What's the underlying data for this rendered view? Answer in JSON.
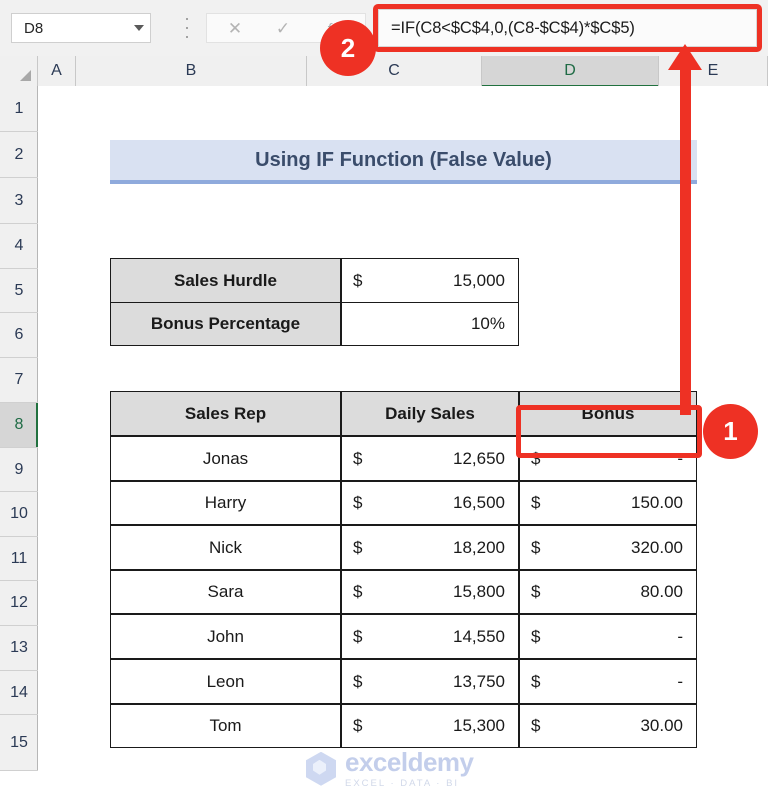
{
  "formula_bar": {
    "name_box_value": "D8",
    "cancel_icon": "close-icon",
    "enter_icon": "check-icon",
    "function_icon": "fx-icon",
    "formula": "=IF(C8<$C$4,0,(C8-$C$4)*$C$5)"
  },
  "grid": {
    "columns": [
      "A",
      "B",
      "C",
      "D",
      "E"
    ],
    "selected_column": "D",
    "rows": [
      "1",
      "2",
      "3",
      "4",
      "5",
      "6",
      "7",
      "8",
      "9",
      "10",
      "11",
      "12",
      "13",
      "14",
      "15"
    ],
    "selected_row": "8"
  },
  "banner": {
    "title": "Using IF Function (False Value)"
  },
  "params_table": {
    "rows": [
      {
        "label": "Sales Hurdle",
        "currency": "$",
        "value": "15,000"
      },
      {
        "label": "Bonus Percentage",
        "currency": "",
        "value": "10%"
      }
    ]
  },
  "data_table": {
    "headers": [
      "Sales Rep",
      "Daily Sales",
      "Bonus"
    ],
    "rows": [
      {
        "rep": "Jonas",
        "sales_cur": "$",
        "sales": "12,650",
        "bonus_cur": "$",
        "bonus": "-"
      },
      {
        "rep": "Harry",
        "sales_cur": "$",
        "sales": "16,500",
        "bonus_cur": "$",
        "bonus": "150.00"
      },
      {
        "rep": "Nick",
        "sales_cur": "$",
        "sales": "18,200",
        "bonus_cur": "$",
        "bonus": "320.00"
      },
      {
        "rep": "Sara",
        "sales_cur": "$",
        "sales": "15,800",
        "bonus_cur": "$",
        "bonus": "80.00"
      },
      {
        "rep": "John",
        "sales_cur": "$",
        "sales": "14,550",
        "bonus_cur": "$",
        "bonus": "-"
      },
      {
        "rep": "Leon",
        "sales_cur": "$",
        "sales": "13,750",
        "bonus_cur": "$",
        "bonus": "-"
      },
      {
        "rep": "Tom",
        "sales_cur": "$",
        "sales": "15,300",
        "bonus_cur": "$",
        "bonus": "30.00"
      }
    ]
  },
  "callouts": {
    "step_one": "1",
    "step_two": "2"
  },
  "watermark": {
    "name": "exceldemy",
    "tagline": "EXCEL · DATA · BI"
  },
  "colors": {
    "accent_red": "#ee3124",
    "banner_fill": "#d9e1f2",
    "banner_border": "#8faadc",
    "header_fill": "#dcdcdc",
    "selection_green": "#21713f"
  }
}
